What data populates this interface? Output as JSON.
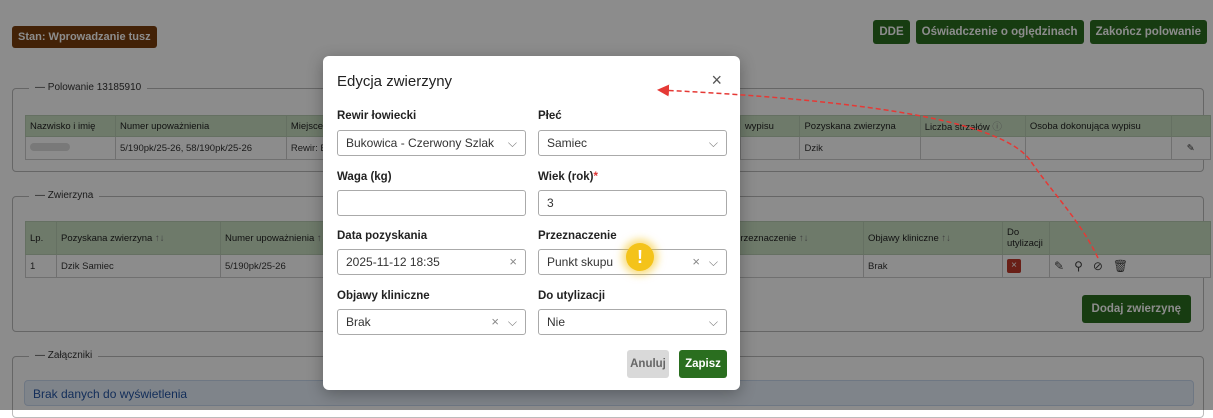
{
  "state_badge": "Stan: Wprowadzanie tusz",
  "top_buttons": {
    "dde": "DDE",
    "statement": "Oświadczenie o oględzinach",
    "finish": "Zakończ polowanie"
  },
  "hunt_section": {
    "legend": "— Polowanie 13185910",
    "headers": [
      "Nazwisko i imię",
      "Numer upoważnienia",
      "Miejsce",
      "wypisu",
      "Pozyskana zwierzyna",
      "Liczba strzałów",
      "Osoba dokonująca wypisu",
      ""
    ],
    "row": {
      "name": "",
      "auth": "5/190pk/25-26, 58/190pk/25-26",
      "place": "Rewir: B",
      "game": "Dzik"
    }
  },
  "game_section": {
    "legend": "— Zwierzyna",
    "headers": {
      "lp": "Lp.",
      "game": "Pozyskana zwierzyna",
      "auth": "Numer upoważnienia",
      "purpose": "Przeznaczenie",
      "symptoms": "Objawy kliniczne",
      "disposal": "Do utylizacji",
      "sort": "↑↓"
    },
    "row": {
      "lp": "1",
      "game": "Dzik Samiec",
      "auth": "5/190pk/25-26",
      "symptoms": "Brak"
    },
    "add_button": "Dodaj zwierzynę"
  },
  "attachments_section": {
    "legend": "— Załączniki",
    "empty": "Brak danych do wyświetlenia"
  },
  "modal": {
    "title": "Edycja zwierzyny",
    "rewir": {
      "label": "Rewir łowiecki",
      "value": "Bukowica - Czerwony Szlak"
    },
    "plec": {
      "label": "Płeć",
      "value": "Samiec"
    },
    "waga": {
      "label": "Waga (kg)",
      "value": ""
    },
    "wiek": {
      "label": "Wiek (rok)",
      "required": "*",
      "value": "3"
    },
    "data": {
      "label": "Data pozyskania",
      "value": "2025-11-12 18:35"
    },
    "przeznaczenie": {
      "label": "Przeznaczenie",
      "value": "Punkt skupu"
    },
    "objawy": {
      "label": "Objawy kliniczne",
      "value": "Brak"
    },
    "utylizacja": {
      "label": "Do utylizacji",
      "value": "Nie"
    },
    "cancel": "Anuluj",
    "save": "Zapisz"
  },
  "colors": {
    "primary": "#2a6e1f",
    "state": "#7a3f0e",
    "header": "#c9dfc2",
    "danger": "#c0392b",
    "warning": "#f4c31a",
    "arrow": "#e53935"
  },
  "icons": [
    "edit-icon",
    "map-pin-icon",
    "paperclip-icon",
    "trash-icon",
    "close-icon",
    "chevron-down-icon",
    "info-icon",
    "warning-icon"
  ]
}
